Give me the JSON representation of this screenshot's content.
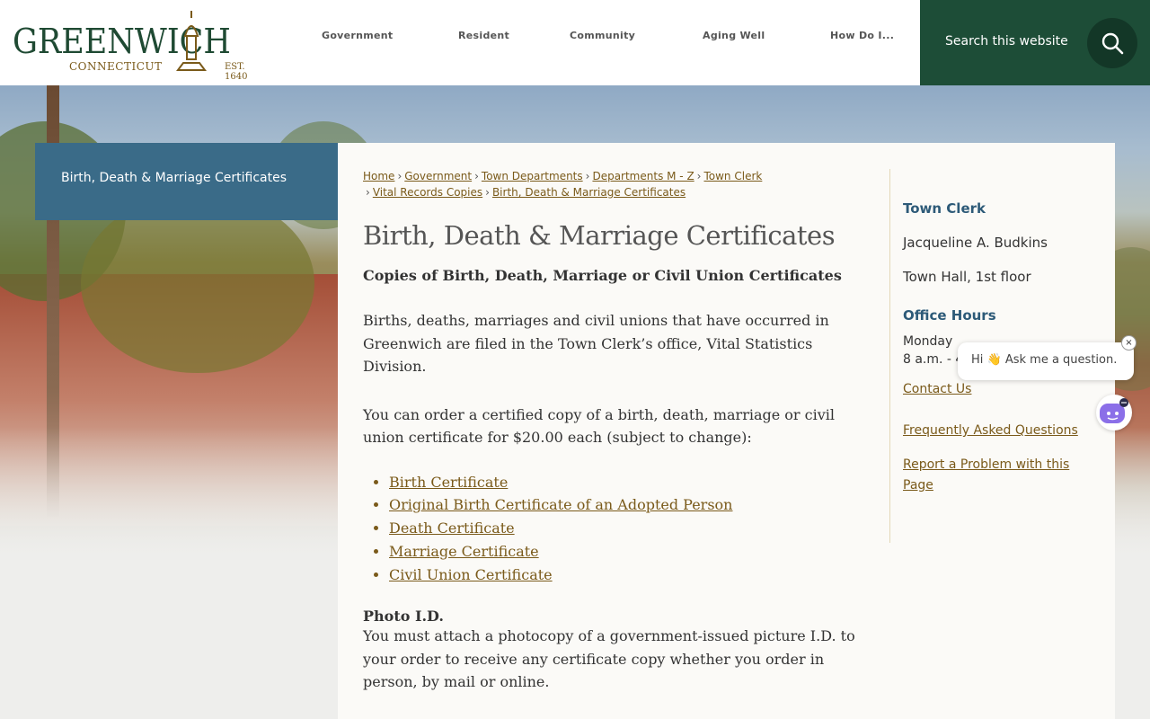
{
  "header": {
    "logo": {
      "wordmark": "GREENWICH",
      "subtitle": "CONNECTICUT",
      "est": "EST. 1640"
    },
    "nav": [
      {
        "label": "Government"
      },
      {
        "label": "Resident"
      },
      {
        "label": "Community"
      },
      {
        "label": "Aging Well"
      },
      {
        "label": "How Do I..."
      }
    ],
    "search": {
      "placeholder": "Search this website",
      "icon": "search-icon"
    }
  },
  "side_title": "Birth, Death & Marriage Certificates",
  "breadcrumb": [
    "Home",
    "Government",
    "Town Departments",
    "Departments M - Z",
    "Town Clerk",
    "Vital Records Copies",
    "Birth, Death & Marriage Certificates"
  ],
  "main": {
    "title": "Birth, Death & Marriage Certificates",
    "subhead": "Copies of Birth, Death, Marriage or Civil Union Certificates",
    "para1": "Births, deaths, marriages and civil unions that have occurred in Greenwich are filed in the Town Clerk’s office, Vital Statistics Division.",
    "para2": "You can order a certified copy of a birth, death, marriage or civil union certificate for $20.00 each (subject to change):",
    "certificates": [
      "Birth Certificate",
      "Original Birth Certificate of an Adopted Person",
      "Death Certificate",
      "Marriage Certificate",
      "Civil Union Certificate"
    ],
    "photo_heading": "Photo I.D.",
    "photo_text": "You must attach a photocopy of a government-issued picture I.D. to your order to receive any certificate copy whether you order in person, by mail or online."
  },
  "sidebar": {
    "dept_heading": "Town Clerk",
    "name": "Jacqueline A. Budkins",
    "location": "Town Hall, 1st floor",
    "hours_heading": "Office Hours",
    "hours_day": "Monday",
    "hours_time": "8 a.m. - 4 p.m.",
    "links": [
      "Contact Us",
      "Frequently Asked Questions",
      "Report a Problem with this Page"
    ]
  },
  "chat": {
    "message": "Hi 👋 Ask me a question.",
    "close": "×"
  },
  "colors": {
    "brand_green": "#1d4d37",
    "title_blue": "#3a6b88",
    "link_gold": "#7a5a1a",
    "heading_blue": "#2d5a78"
  }
}
